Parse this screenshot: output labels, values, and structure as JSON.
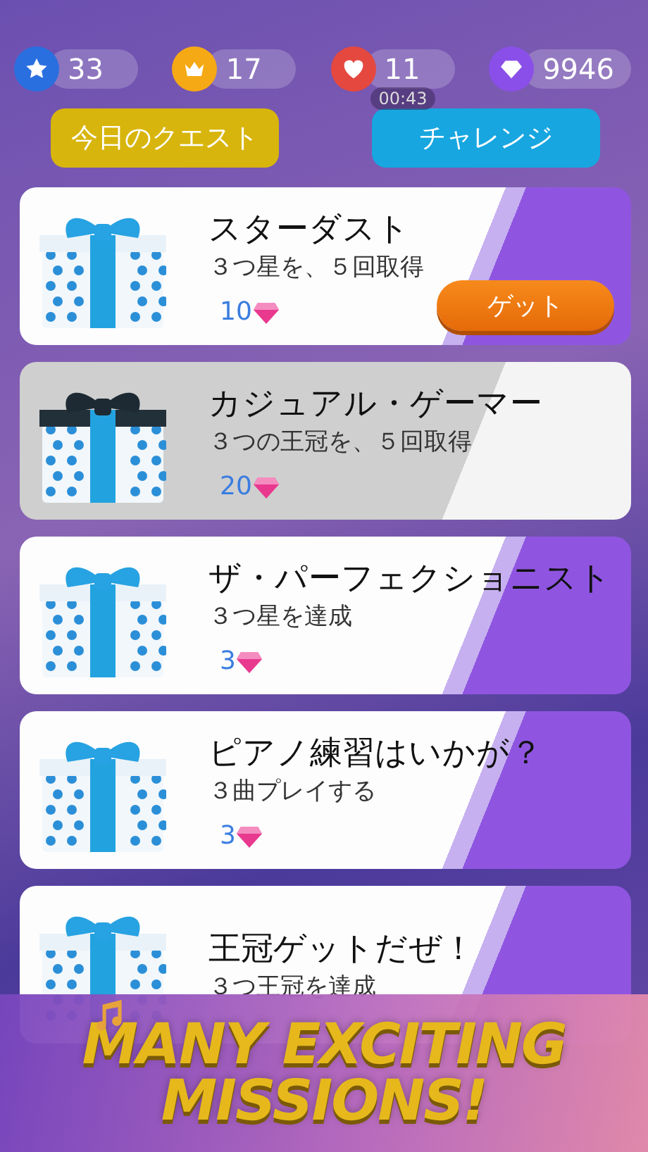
{
  "stats": [
    {
      "kind": "star",
      "value": "33",
      "color": "#2a6fe0"
    },
    {
      "kind": "crown",
      "value": "17",
      "color": "#f5a915"
    },
    {
      "kind": "heart",
      "value": "11",
      "color": "#e5483f",
      "timer": "00:43"
    },
    {
      "kind": "gem",
      "value": "9946",
      "color": "#8a4fe8"
    }
  ],
  "tabs": [
    {
      "label": "今日のクエスト",
      "color": "#d8b50c"
    },
    {
      "label": "チャレンジ",
      "color": "#17a6e0"
    }
  ],
  "missions": [
    {
      "title": "スターダスト",
      "description": "３つ星を、５回取得",
      "reward": "10",
      "completed": false,
      "button": "ゲット"
    },
    {
      "title": "カジュアル・ゲーマー",
      "description": "３つの王冠を、５回取得",
      "reward": "20",
      "completed": true
    },
    {
      "title": "ザ・パーフェクショニスト",
      "description": "３つ星を達成",
      "reward": "3",
      "completed": false
    },
    {
      "title": "ピアノ練習はいかが？",
      "description": "３曲プレイする",
      "reward": "3",
      "completed": false
    },
    {
      "title": "王冠ゲットだぜ！",
      "description": "３つ王冠を達成",
      "completed": false
    }
  ],
  "banner": {
    "lines": [
      "MANY EXCITING",
      "MISSIONS!"
    ]
  }
}
